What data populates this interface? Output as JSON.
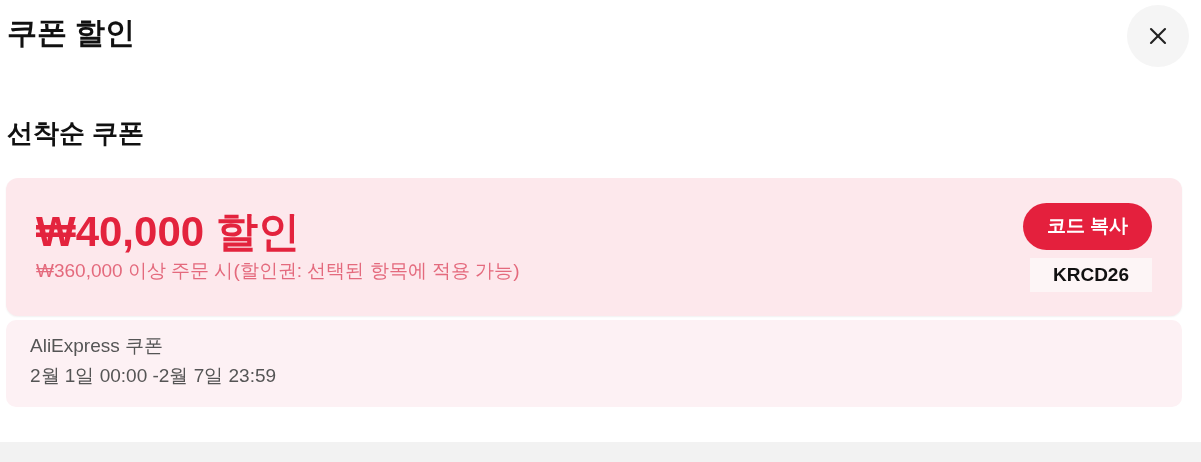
{
  "title": "쿠폰 할인",
  "section_title": "선착순 쿠폰",
  "coupon": {
    "amount": "₩40,000 할인",
    "condition": "₩360,000 이상 주문 시(할인권: 선택된 항목에 적용 가능)",
    "copy_button": "코드 복사",
    "code": "KRCD26",
    "issuer": "AliExpress 쿠폰",
    "validity": "2월 1일 00:00 -2월 7일 23:59"
  }
}
